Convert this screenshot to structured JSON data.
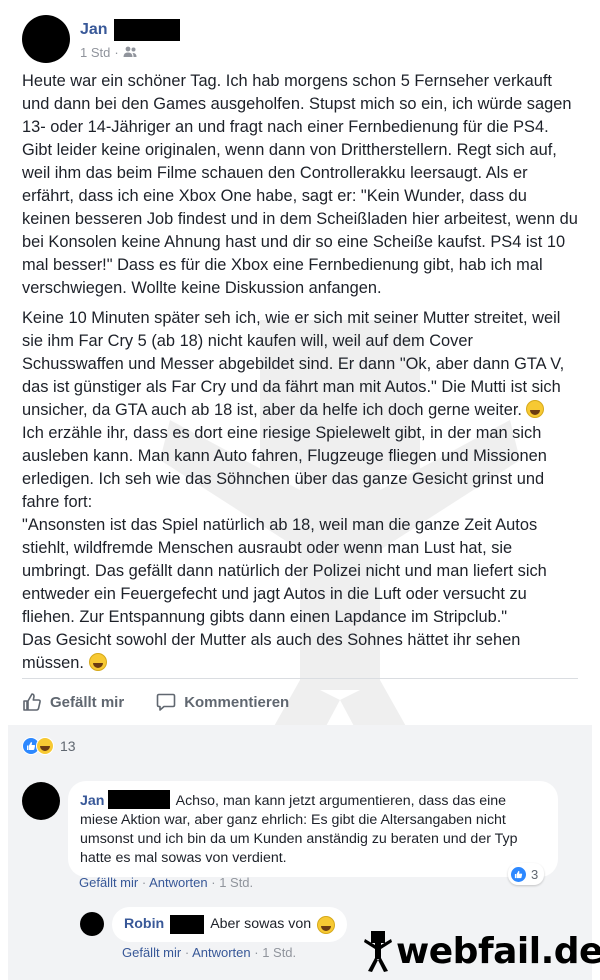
{
  "post": {
    "author": "Jan",
    "time": "1 Std",
    "separator": "·",
    "paragraph1": "Heute war ein schöner Tag. Ich hab morgens schon 5 Fernseher verkauft und dann bei den Games ausgeholfen. Stupst mich so ein, ich würde sagen 13- oder 14-Jähriger an und fragt nach einer Fernbedienung für die PS4. Gibt leider keine originalen, wenn dann von Drittherstellern. Regt sich auf, weil ihm das beim Filme schauen den Controllerakku leersaugt. Als er erfährt, dass ich eine Xbox One habe, sagt er: \"Kein Wunder, dass du keinen besseren Job findest und in dem Scheißladen hier arbeitest, wenn du bei Konsolen keine Ahnung hast und dir so eine Scheiße kaufst. PS4 ist 10 mal besser!\" Dass es für die Xbox eine Fernbedienung gibt, hab ich mal verschwiegen. Wollte keine Diskussion anfangen.",
    "paragraph2a": "Keine 10 Minuten später seh ich, wie er sich mit seiner Mutter streitet, weil sie ihm Far Cry 5 (ab 18) nicht kaufen will, weil auf dem Cover Schusswaffen und Messer abgebildet sind. Er dann \"Ok, aber dann GTA V, das ist günstiger als Far Cry und da fährt man mit Autos.\" Die Mutti ist sich unsicher, da GTA auch ab 18 ist, aber da helfe ich doch gerne weiter. ",
    "paragraph2b": "\nIch erzähle ihr, dass es dort eine riesige Spielewelt gibt, in der man sich ausleben kann. Man kann Auto fahren, Flugzeuge fliegen und Missionen erledigen. Ich seh wie das Söhnchen über das ganze Gesicht grinst und fahre fort:\n\"Ansonsten ist das Spiel natürlich ab 18, weil man die ganze Zeit Autos stiehlt, wildfremde Menschen ausraubt oder wenn man Lust hat, sie umbringt. Das gefällt dann natürlich der Polizei nicht und man liefert sich entweder ein Feuergefecht und jagt Autos in die Luft oder versucht zu fliehen. Zur Entspannung gibts dann einen Lapdance im Stripclub.\"\nDas Gesicht sowohl der Mutter als auch des Sohnes hättet ihr sehen müssen. "
  },
  "actions": {
    "like": "Gefällt mir",
    "comment": "Kommentieren"
  },
  "reactions": {
    "count": "13"
  },
  "comments": [
    {
      "author": "Jan",
      "text": "Achso, man kann jetzt argumentieren, dass das eine miese Aktion war, aber ganz ehrlich: Es gibt die Altersangaben nicht umsonst und ich bin da um Kunden anständig zu beraten und der Typ hatte es mal sowas von verdient.",
      "like": "Gefällt mir",
      "reply": "Antworten",
      "time": "1 Std.",
      "reaction_count": "3"
    },
    {
      "author": "Robin",
      "text": "Aber sowas von",
      "like": "Gefällt mir",
      "reply": "Antworten",
      "time": "1 Std."
    }
  ],
  "watermark": {
    "logo_text": "webfail.de"
  },
  "icons": {
    "audience": "friends-icon",
    "like": "thumbs-up-icon",
    "comment": "speech-bubble-icon",
    "emoji": "grinning-face-icon"
  },
  "colors": {
    "link": "#385898",
    "muted": "#90949c",
    "text": "#1d2129",
    "comment_bg": "#f2f3f5",
    "like_blue": "#2d88ff"
  }
}
